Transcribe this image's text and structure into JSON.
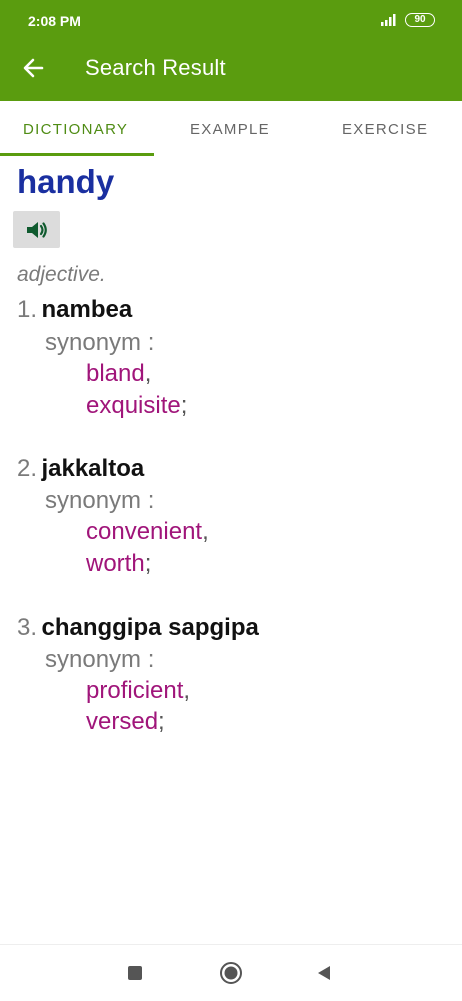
{
  "status": {
    "time": "2:08 PM",
    "battery": "90"
  },
  "appbar": {
    "title": "Search Result"
  },
  "tabs": [
    {
      "label": "DICTIONARY"
    },
    {
      "label": "EXAMPLE"
    },
    {
      "label": "EXERCISE"
    }
  ],
  "entry": {
    "word": "handy",
    "part_of_speech": "adjective.",
    "synonym_label": "synonym :",
    "senses": [
      {
        "number": "1.",
        "meaning": "nambea",
        "synonyms": [
          "bland",
          "exquisite"
        ],
        "separators": [
          ",",
          ";"
        ]
      },
      {
        "number": "2.",
        "meaning": "jakkaltoa",
        "synonyms": [
          "convenient",
          "worth"
        ],
        "separators": [
          ",",
          ";"
        ]
      },
      {
        "number": "3.",
        "meaning": "changgipa sapgipa",
        "synonyms": [
          "proficient",
          "versed"
        ],
        "separators": [
          ",",
          ";"
        ]
      }
    ]
  },
  "icons": {
    "back": "arrow-left-icon",
    "audio": "speaker-icon",
    "nav_recent": "square-icon",
    "nav_home": "circle-icon",
    "nav_back": "triangle-back-icon"
  },
  "colors": {
    "primary": "#5a9c0f",
    "headword": "#1a2fa0",
    "synonym": "#a0157a"
  }
}
